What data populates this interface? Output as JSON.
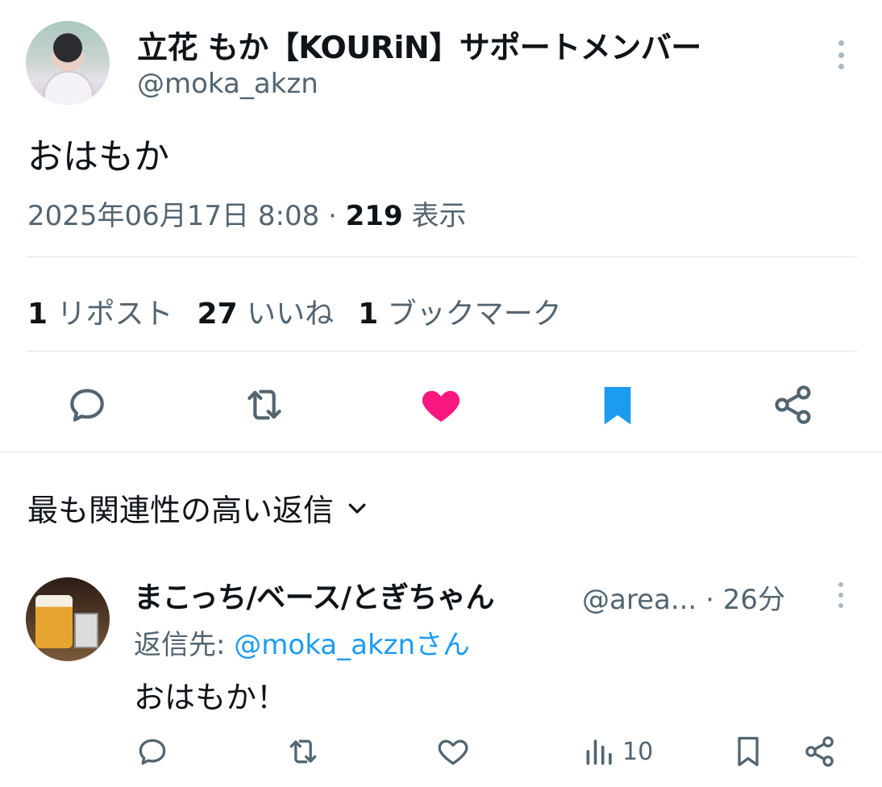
{
  "tweet": {
    "display_name": "立花 もか【KOURiN】サポートメンバー",
    "handle": "@moka_akzn",
    "text": "おはもか",
    "timestamp": "2025年06月17日 8:08",
    "separator": " · ",
    "views_count": "219",
    "views_label": "表示",
    "stats": {
      "reposts_count": "1",
      "reposts_label": "リポスト",
      "likes_count": "27",
      "likes_label": "いいね",
      "bookmarks_count": "1",
      "bookmarks_label": "ブックマーク"
    },
    "actions": {
      "reply_icon": "reply-icon",
      "repost_icon": "repost-icon",
      "like_icon": "heart-filled-icon",
      "bookmark_icon": "bookmark-filled-icon",
      "share_icon": "share-icon"
    }
  },
  "replies_section": {
    "sort_label": "最も関連性の高い返信"
  },
  "reply": {
    "display_name": "まこっち/ベース/とぎちゃん",
    "handle": "@area...",
    "time": "· 26分",
    "reply_to_prefix": "返信先: ",
    "reply_to_mention": "@moka_akznさん",
    "text": "おはもか！",
    "views_count": "10"
  },
  "colors": {
    "text_primary": "#0f1419",
    "text_secondary": "#536471",
    "like_pink": "#f91880",
    "bookmark_blue": "#1d9bf0",
    "mention_blue": "#1d9bf0",
    "divider": "#e1e6ea"
  }
}
